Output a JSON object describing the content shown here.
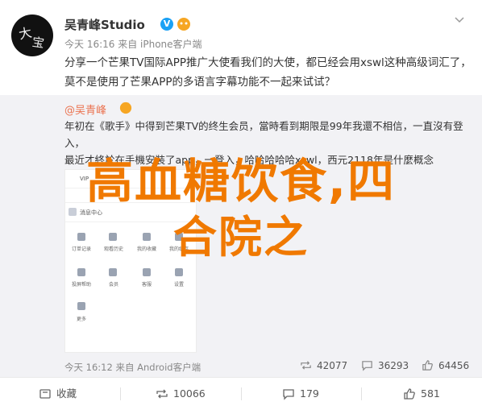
{
  "post": {
    "author": "吴青峰Studio",
    "meta": "今天 16:16 来自 iPhone客户端",
    "text": "分享一个芒果TV国际APP推广大使看我们的大使，都已经会用xswl这种高级词汇了，莫不是使用了芒果APP的多语言字幕功能不一起来试试？"
  },
  "quoted": {
    "author": "@吴青峰",
    "text_lines": [
      "年初在《歌手》中得到芒果TV的终生会员，當時看到期限是99年我還不相信，一直沒有登入，",
      "最近才終於在手機安裝了app，一登入，哈哈哈哈哈xswl，西元2118年是什麼概念",
      "哦！！！！"
    ],
    "screenshot": {
      "top_label": "VIP",
      "rows": [
        "消息中心"
      ],
      "grid_row1": [
        "订单记录",
        "观看历史",
        "我的收藏",
        "我的缓存"
      ],
      "grid_row2": [
        "投屏帮助",
        "会员",
        "客服",
        "设置"
      ],
      "bottom": "更多"
    },
    "meta": "今天 16:12 来自 Android客户端",
    "stats": {
      "reposts": "42077",
      "comments": "36293",
      "likes": "64456"
    }
  },
  "overlay": {
    "line1": "高血糖饮食,四",
    "line2": "合院之"
  },
  "actions": {
    "reposts": "10066",
    "comments": "179",
    "likes": "581"
  },
  "colors": {
    "accent": "#eb7350",
    "overlay": "#f07900",
    "vip": "#1aa1f5"
  }
}
